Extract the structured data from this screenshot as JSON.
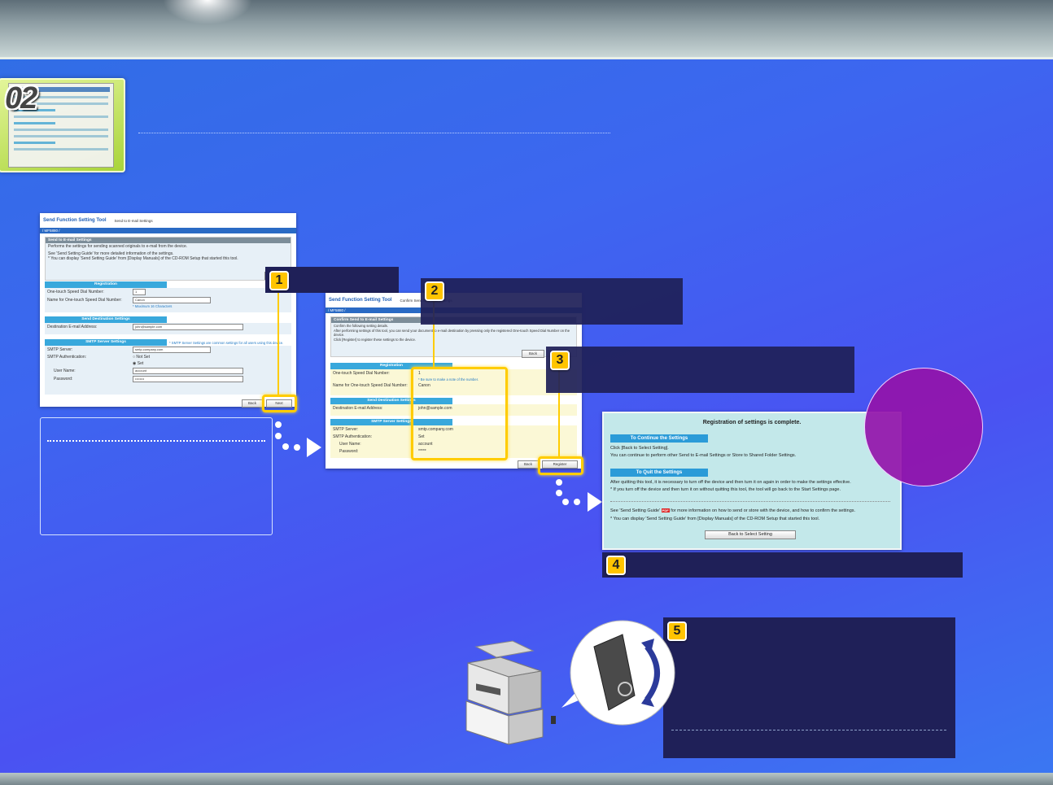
{
  "step": {
    "number": "02"
  },
  "window1": {
    "app_title": "Send Function Setting Tool",
    "subtitle": "Send to E-mail Settings",
    "model": "/ MF5880 /",
    "panel_title": "Send to E-mail Settings",
    "desc1": "Performs the settings for sending scanned originals to e-mail from the device.",
    "desc2": "See 'Send Setting Guide' for more detailed information of the settings.",
    "desc3": "* You can display 'Send Setting Guide' from [Display Manuals] of the CD-ROM Setup that started this tool.",
    "back": "Back",
    "registration": "Registration",
    "speed_dial_label": "One-touch Speed Dial Number:",
    "speed_dial_value": "1",
    "name_label": "Name for One-touch Speed Dial Number:",
    "name_value": "Canon",
    "name_hint": "* Maximum 16 Characters",
    "dest_settings": "Send Destination Settings",
    "dest_label": "Destination E-mail Address:",
    "dest_value": "john@sample.com",
    "smtp_settings": "SMTP Server Settings",
    "smtp_note": "* SMTP Server Settings are common settings for all users using this device.",
    "smtp_server_label": "SMTP Server:",
    "smtp_server_value": "smtp.company.com",
    "smtp_auth_label": "SMTP Authentication:",
    "not_set": "Not Set",
    "set": "Set",
    "user_label": "User Name:",
    "user_value": "account",
    "pass_label": "Password:",
    "pass_value": "••••••••",
    "back2": "Back",
    "next": "Next"
  },
  "window2": {
    "app_title": "Send Function Setting Tool",
    "subtitle": "Confirm Send to E-mail Settings",
    "model": "/ MF5880 /",
    "panel_title": "Confirm Send to E-mail Settings",
    "desc1": "Confirm the following setting details.",
    "desc2": "After performing settings of this tool, you can send your document to e-mail destination by pressing only the registered One-touch Speed Dial Number on the device.",
    "desc3": "Click [Register] to register these settings to the device.",
    "back": "Back",
    "registration": "Registration",
    "speed_dial_label": "One-touch Speed Dial Number:",
    "speed_dial_value": "1",
    "speed_dial_note": "* Be sure to make a note of the number.",
    "name_label": "Name for One-touch Speed Dial Number:",
    "name_value": "Canon",
    "dest_settings": "Send Destination Settings",
    "dest_label": "Destination E-mail Address:",
    "dest_value": "john@sample.com",
    "smtp_settings": "SMTP Server Settings",
    "smtp_server_label": "SMTP Server:",
    "smtp_server_value": "smtp.company.com",
    "smtp_auth_label": "SMTP Authentication:",
    "smtp_auth_value": "Set",
    "user_label": "User Name:",
    "user_value": "account",
    "pass_label": "Password:",
    "pass_value": "*****",
    "back2": "Back",
    "register": "Register"
  },
  "complete": {
    "heading": "Registration of settings is complete.",
    "continue_title": "To Continue the Settings",
    "continue_1": "Click [Back to Select Setting].",
    "continue_2": "You can continue to perform other Send to E-mail Settings or Store to Shared Folder Settings.",
    "quit_title": "To Quit the Settings",
    "quit_1": "After quitting this tool, it is necessary to turn off the device and then turn it on again in order to make the settings effective.",
    "quit_2": "* If you turn off the device and then turn it on without quitting this tool, the tool will go back to the Start Settings page.",
    "guide_1a": "See 'Send Setting Guide'",
    "pdf": "PDF",
    "guide_1b": "for more information on how to send or store with the device, and how to confirm the settings.",
    "guide_2": "* You can display 'Send Setting Guide' from [Display Manuals] of the CD-ROM Setup that started this tool.",
    "back_button": "Back to Select Setting"
  },
  "badges": [
    "1",
    "2",
    "3",
    "4",
    "5"
  ],
  "colors": {
    "highlight": "#ffcc00",
    "navy": "#1f2058",
    "accent": "#38a8dc"
  }
}
